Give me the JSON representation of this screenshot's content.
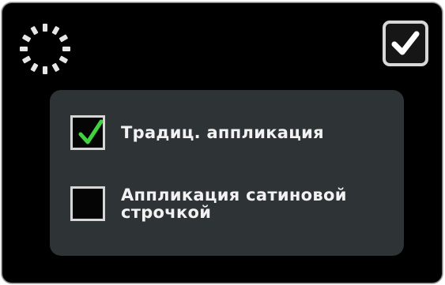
{
  "dialog": {
    "busy_indicator": "spinner-icon",
    "confirm_button": {
      "icon": "checkmark-icon",
      "color": "#ffffff"
    },
    "options": [
      {
        "label": "Традиц. аппликация",
        "checked": true,
        "check_color": "#3fd33f"
      },
      {
        "label": "Аппликация сатиновой\nстрочкой",
        "checked": false
      }
    ]
  }
}
